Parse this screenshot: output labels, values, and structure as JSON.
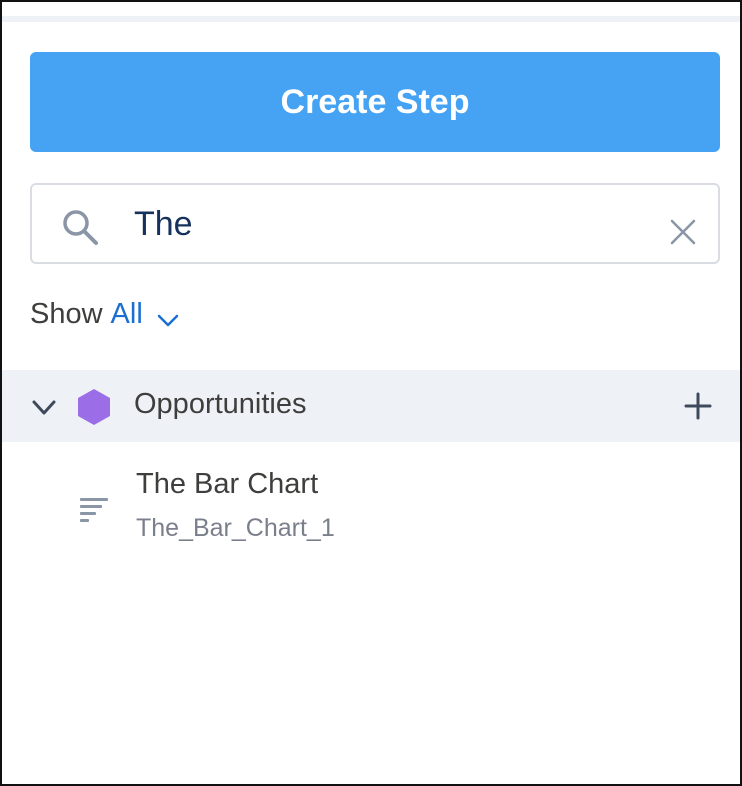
{
  "toolbar": {
    "create_label": "Create Step"
  },
  "search": {
    "value": "The"
  },
  "filter": {
    "show_label": "Show",
    "show_value": "All"
  },
  "group": {
    "title": "Opportunities"
  },
  "items": [
    {
      "title": "The Bar Chart",
      "api_name": "The_Bar_Chart_1"
    }
  ],
  "colors": {
    "accent": "#46a3f4",
    "group_bg": "#eef1f6",
    "hex_icon": "#9b6ee8",
    "link": "#1b6fd1"
  }
}
